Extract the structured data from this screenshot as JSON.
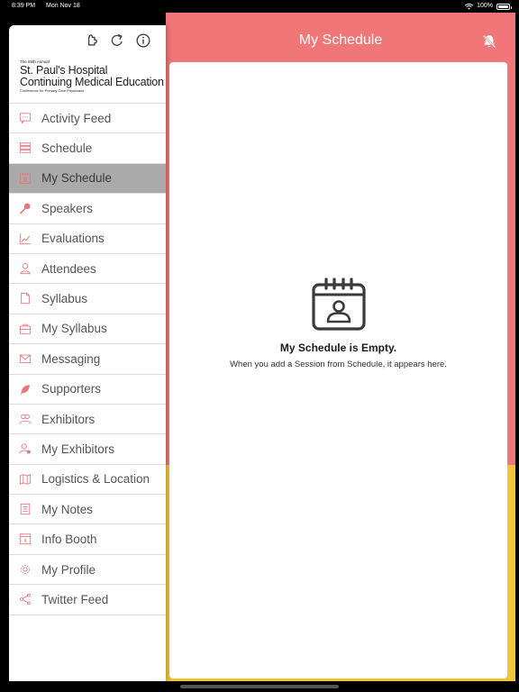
{
  "status_bar": {
    "time": "8:39 PM",
    "date": "Mon Nov 18",
    "battery": "100%"
  },
  "main": {
    "title": "My Schedule",
    "empty_title": "My Schedule is Empty.",
    "empty_subtitle": "When you add a Session from Schedule, it appears here."
  },
  "logo": {
    "line1": "The 65th Annual",
    "line2": "St. Paul's Hospital",
    "line3": "Continuing Medical Education",
    "line4": "Conference for Primary Care Physicians"
  },
  "nav": [
    {
      "label": "Activity Feed",
      "icon": "chat-icon"
    },
    {
      "label": "Schedule",
      "icon": "schedule-icon"
    },
    {
      "label": "My Schedule",
      "icon": "my-schedule-icon",
      "active": true
    },
    {
      "label": "Speakers",
      "icon": "microphone-icon"
    },
    {
      "label": "Evaluations",
      "icon": "chart-icon"
    },
    {
      "label": "Attendees",
      "icon": "person-icon"
    },
    {
      "label": "Syllabus",
      "icon": "document-icon"
    },
    {
      "label": "My Syllabus",
      "icon": "briefcase-icon"
    },
    {
      "label": "Messaging",
      "icon": "envelope-icon"
    },
    {
      "label": "Supporters",
      "icon": "leaf-icon"
    },
    {
      "label": "Exhibitors",
      "icon": "exhibitors-icon"
    },
    {
      "label": "My Exhibitors",
      "icon": "my-exhibitors-icon"
    },
    {
      "label": "Logistics & Location",
      "icon": "map-icon"
    },
    {
      "label": "My Notes",
      "icon": "notes-icon"
    },
    {
      "label": "Info Booth",
      "icon": "info-booth-icon"
    },
    {
      "label": "My Profile",
      "icon": "gear-icon"
    },
    {
      "label": "Twitter Feed",
      "icon": "share-icon"
    }
  ],
  "colors": {
    "accent": "#f07678",
    "lower_accent": "#f2c43a",
    "active_row": "#aaaaaa",
    "icon": "#e8767a"
  }
}
